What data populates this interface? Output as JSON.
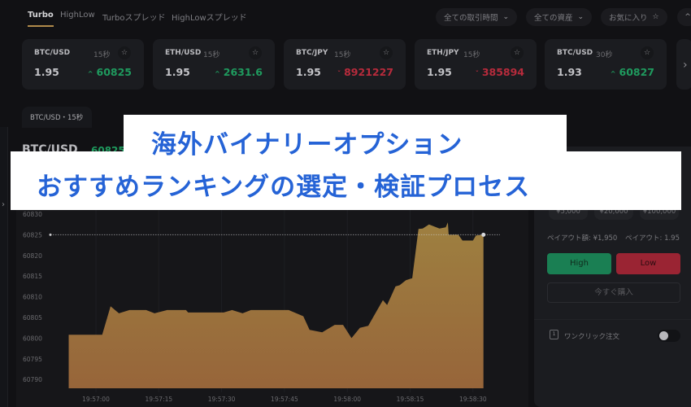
{
  "top_tabs": [
    {
      "label": "Turbo",
      "active": true
    },
    {
      "label": "HighLow",
      "active": false
    },
    {
      "label": "Turboスプレッド",
      "active": false
    },
    {
      "label": "HighLowスプレッド",
      "active": false
    }
  ],
  "filters": {
    "trade_time": "全ての取引時間",
    "assets": "全ての資産",
    "favorites": "お気に入り",
    "collapse_icon": "chevron-up-icon"
  },
  "asset_cards": [
    {
      "symbol": "BTC/USD",
      "duration": "15秒",
      "payout": "1.95",
      "price": "60825",
      "direction": "up"
    },
    {
      "symbol": "ETH/USD",
      "duration": "15秒",
      "payout": "1.95",
      "price": "2631.6",
      "direction": "up"
    },
    {
      "symbol": "BTC/JPY",
      "duration": "15秒",
      "payout": "1.95",
      "price": "8921227",
      "direction": "down"
    },
    {
      "symbol": "ETH/JPY",
      "duration": "15秒",
      "payout": "1.95",
      "price": "385894",
      "direction": "down"
    },
    {
      "symbol": "BTC/USD",
      "duration": "30秒",
      "payout": "1.93",
      "price": "60827",
      "direction": "up"
    }
  ],
  "glyphs": {
    "up": "^",
    "down": "ˇ",
    "star": "☆",
    "chevron_down": "⌄",
    "chevron_right": "›",
    "chevron_up": "^"
  },
  "chart_tab": "BTC/USD・15秒",
  "chart_header": {
    "symbol": "BTC/USD",
    "price": "60825"
  },
  "chart_data": {
    "type": "area",
    "title": "BTC/USD",
    "xlabel": "",
    "ylabel": "",
    "y_ticks": [
      60830,
      60825,
      60820,
      60815,
      60810,
      60805,
      60800,
      60795,
      60790
    ],
    "x_ticks": [
      "19:57:00",
      "19:57:15",
      "19:57:30",
      "19:57:45",
      "19:58:00",
      "19:58:15",
      "19:58:30"
    ],
    "ylim": [
      60788,
      60832
    ],
    "x_range_seconds": [
      -6.5,
      96
    ],
    "current_price_line": 60825,
    "colors": {
      "area_top": "#9e8040",
      "area_bottom": "#97653a",
      "price_line": "#c9c9cc"
    },
    "points": [
      {
        "t": -6.5,
        "v": 60800.8
      },
      {
        "t": 1.5,
        "v": 60800.8
      },
      {
        "t": 3.5,
        "v": 60807.7
      },
      {
        "t": 5.5,
        "v": 60806.0
      },
      {
        "t": 8.0,
        "v": 60806.8
      },
      {
        "t": 12.0,
        "v": 60806.8
      },
      {
        "t": 14.0,
        "v": 60806.0
      },
      {
        "t": 17.0,
        "v": 60806.8
      },
      {
        "t": 21.5,
        "v": 60806.8
      },
      {
        "t": 22.0,
        "v": 60806.2
      },
      {
        "t": 30.5,
        "v": 60806.2
      },
      {
        "t": 32.5,
        "v": 60806.8
      },
      {
        "t": 35.0,
        "v": 60806.0
      },
      {
        "t": 37.0,
        "v": 60806.8
      },
      {
        "t": 46.0,
        "v": 60806.8
      },
      {
        "t": 49.5,
        "v": 60805.3
      },
      {
        "t": 51.0,
        "v": 60802.0
      },
      {
        "t": 54.0,
        "v": 60801.4
      },
      {
        "t": 57.0,
        "v": 60803.2
      },
      {
        "t": 59.0,
        "v": 60803.2
      },
      {
        "t": 61.0,
        "v": 60800.0
      },
      {
        "t": 63.0,
        "v": 60802.5
      },
      {
        "t": 65.0,
        "v": 60803.0
      },
      {
        "t": 68.5,
        "v": 60809.2
      },
      {
        "t": 69.5,
        "v": 60808.0
      },
      {
        "t": 71.5,
        "v": 60812.5
      },
      {
        "t": 72.5,
        "v": 60812.8
      },
      {
        "t": 74.0,
        "v": 60814.0
      },
      {
        "t": 75.5,
        "v": 60814.5
      },
      {
        "t": 77.0,
        "v": 60826.4
      },
      {
        "t": 78.0,
        "v": 60826.5
      },
      {
        "t": 79.5,
        "v": 60827.5
      },
      {
        "t": 82.0,
        "v": 60826.5
      },
      {
        "t": 83.5,
        "v": 60826.8
      },
      {
        "t": 84.0,
        "v": 60828.0
      },
      {
        "t": 84.2,
        "v": 60825.0
      },
      {
        "t": 86.5,
        "v": 60825.0
      },
      {
        "t": 87.5,
        "v": 60823.6
      },
      {
        "t": 90.0,
        "v": 60823.6
      },
      {
        "t": 90.7,
        "v": 60824.8
      },
      {
        "t": 92.5,
        "v": 60825.0
      }
    ]
  },
  "side_panel": {
    "amounts": [
      "¥5,000",
      "¥20,000",
      "¥100,000"
    ],
    "payout_amount": "ペイアウト額: ¥1,950",
    "payout_rate": "ペイアウト: 1.95",
    "high_label": "High",
    "low_label": "Low",
    "buy_label": "今すぐ購入",
    "oneclick_label": "ワンクリック注文",
    "oneclick_icon_text": "1",
    "oneclick_enabled": false
  },
  "banner": {
    "line1": "海外バイナリーオプション",
    "line2": "おすすめランキングの選定・検証プロセス"
  }
}
